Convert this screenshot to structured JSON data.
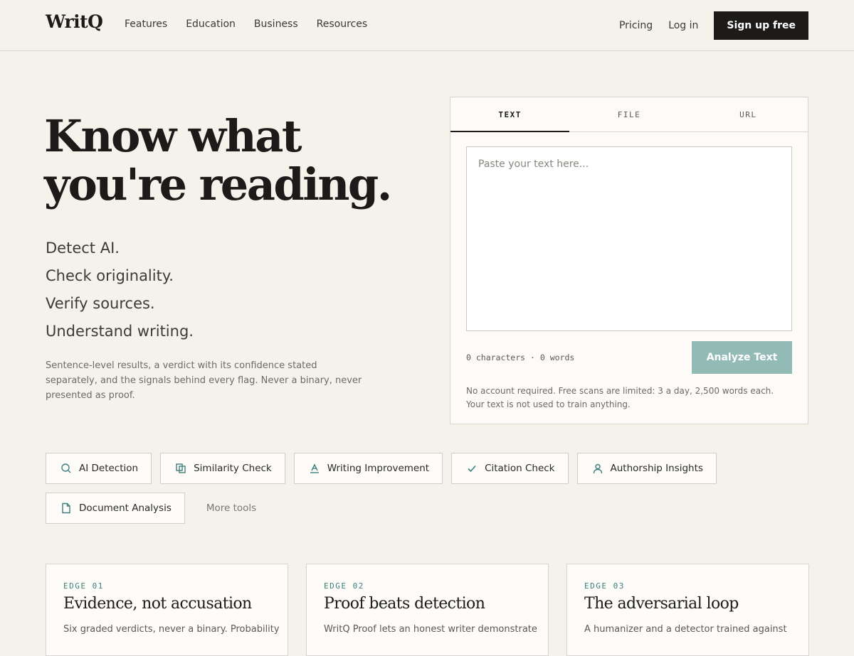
{
  "nav": {
    "logo": "WritQ",
    "links": [
      "Features",
      "Education",
      "Business",
      "Resources"
    ],
    "pricing": "Pricing",
    "login": "Log in",
    "signup": "Sign up free"
  },
  "hero": {
    "title_line1": "Know what",
    "title_line2": "you're reading.",
    "taglines": [
      "Detect AI.",
      "Check originality.",
      "Verify sources.",
      "Understand writing."
    ],
    "description": "Sentence-level results, a verdict with its confidence stated separately, and the signals behind every flag. Never a binary, never presented as proof."
  },
  "analyzer": {
    "tabs": [
      "TEXT",
      "FILE",
      "URL"
    ],
    "active_tab": "TEXT",
    "placeholder": "Paste your text here...",
    "value": "",
    "counter": "0 characters · 0 words",
    "button": "Analyze Text",
    "note": "No account required. Free scans are limited: 3 a day, 2,500 words each. Your text is not used to train anything."
  },
  "tools": {
    "items": [
      {
        "label": "AI Detection",
        "icon": "search-icon"
      },
      {
        "label": "Similarity Check",
        "icon": "copy-icon"
      },
      {
        "label": "Writing Improvement",
        "icon": "pen-icon"
      },
      {
        "label": "Citation Check",
        "icon": "check-icon"
      },
      {
        "label": "Authorship Insights",
        "icon": "user-icon"
      },
      {
        "label": "Document Analysis",
        "icon": "document-icon"
      }
    ],
    "more": "More tools"
  },
  "edges": [
    {
      "eyebrow": "EDGE 01",
      "title": "Evidence, not accusation",
      "body": "Six graded verdicts, never a binary. Probability"
    },
    {
      "eyebrow": "EDGE 02",
      "title": "Proof beats detection",
      "body": "WritQ Proof lets an honest writer demonstrate"
    },
    {
      "eyebrow": "EDGE 03",
      "title": "The adversarial loop",
      "body": "A humanizer and a detector trained against"
    }
  ],
  "colors": {
    "background": "#f5f2eb",
    "ink": "#1c1b19",
    "accent_teal": "#3e7f7b",
    "analyze_button": "#93bbb6"
  }
}
